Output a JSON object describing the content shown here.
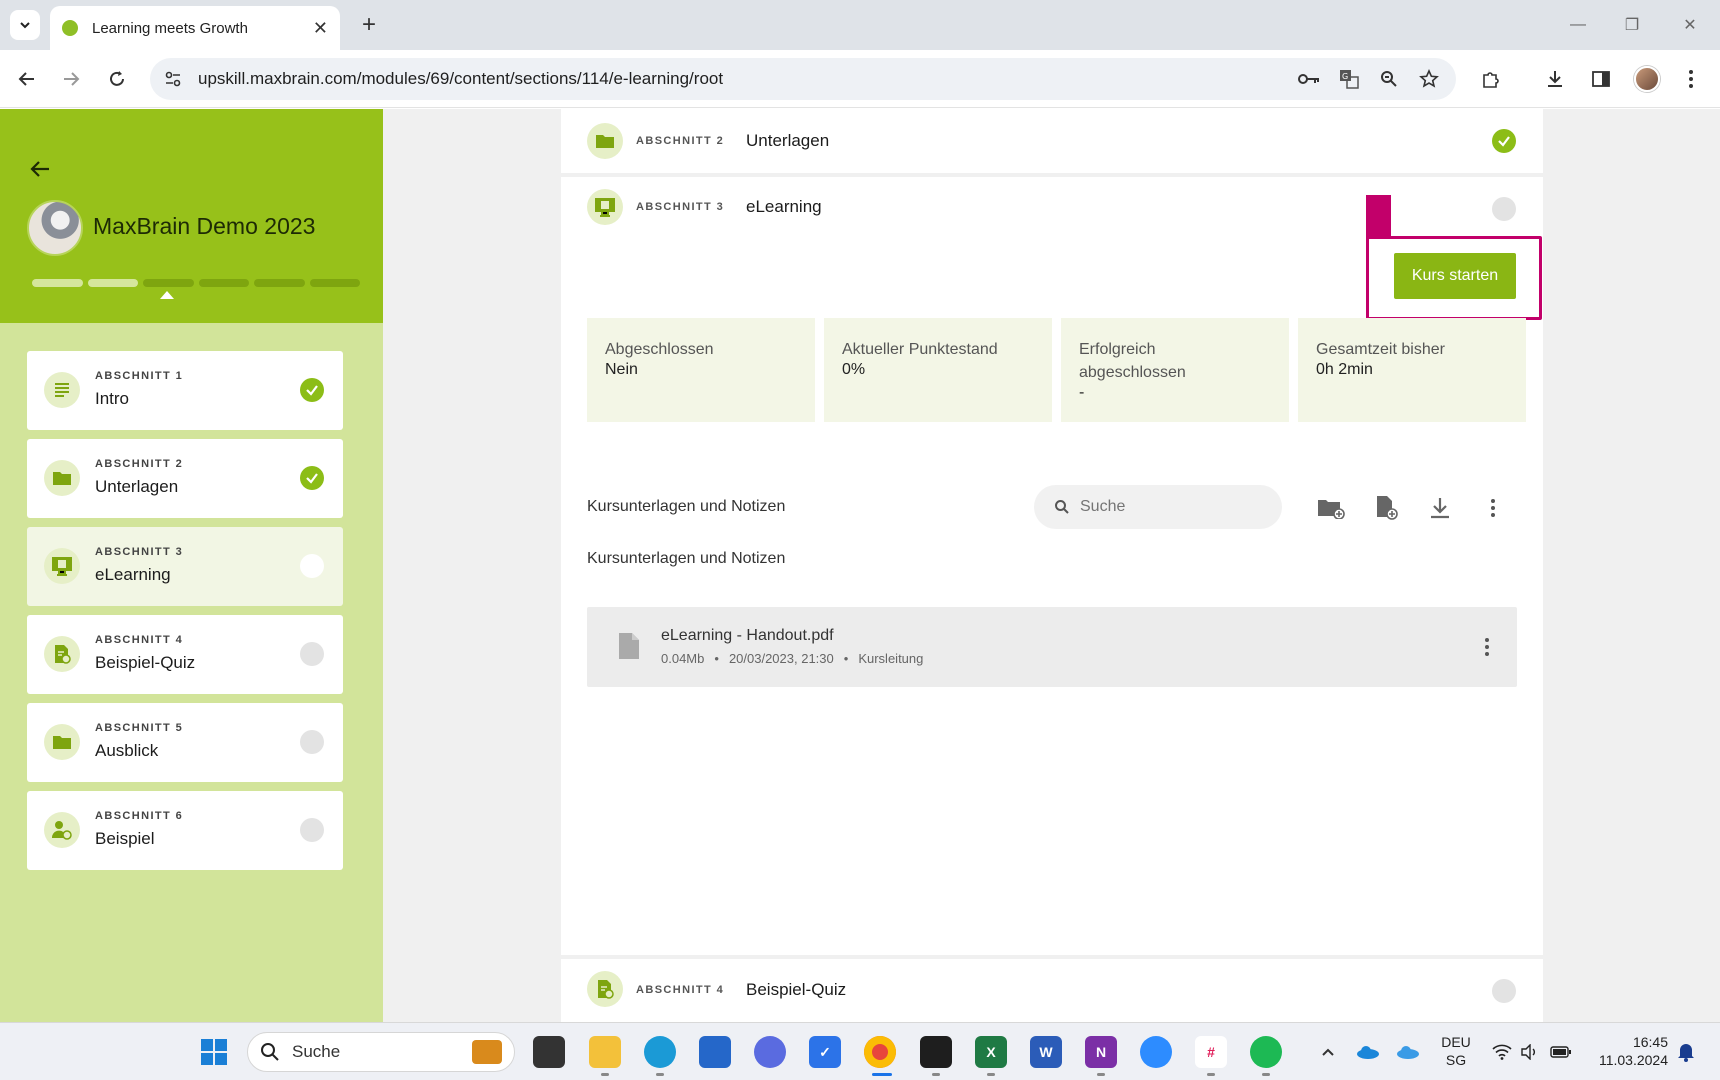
{
  "browser": {
    "tab_title": "Learning meets Growth",
    "url": "upskill.maxbrain.com/modules/69/content/sections/114/e-learning/root"
  },
  "sidebar": {
    "course_title": "MaxBrain Demo 2023",
    "items": [
      {
        "section": "ABSCHNITT 1",
        "name": "Intro",
        "status": "done",
        "icon": "text-lines-icon"
      },
      {
        "section": "ABSCHNITT 2",
        "name": "Unterlagen",
        "status": "done",
        "icon": "folder-icon"
      },
      {
        "section": "ABSCHNITT 3",
        "name": "eLearning",
        "status": "open",
        "icon": "elearning-monitor-icon"
      },
      {
        "section": "ABSCHNITT 4",
        "name": "Beispiel-Quiz",
        "status": "open",
        "icon": "quiz-document-icon"
      },
      {
        "section": "ABSCHNITT 5",
        "name": "Ausblick",
        "status": "open",
        "icon": "folder-icon"
      },
      {
        "section": "ABSCHNITT 6",
        "name": "Beispiel",
        "status": "open",
        "icon": "person-clock-icon"
      }
    ]
  },
  "main": {
    "section2": {
      "section": "ABSCHNITT 2",
      "name": "Unterlagen"
    },
    "section3": {
      "section": "ABSCHNITT 3",
      "name": "eLearning"
    },
    "start_button": "Kurs starten",
    "stats": [
      {
        "label": "Abgeschlossen",
        "value": "Nein"
      },
      {
        "label": "Aktueller Punktestand",
        "value": "0%"
      },
      {
        "label": "Erfolgreich abgeschlossen",
        "value": "-"
      },
      {
        "label": "Gesamtzeit bisher",
        "value": "0h 2min"
      }
    ],
    "notes_heading": "Kursunterlagen und Notizen",
    "notes_subheading": "Kursunterlagen und Notizen",
    "search_placeholder": "Suche",
    "file": {
      "name": "eLearning - Handout.pdf",
      "size": "0.04Mb",
      "date": "20/03/2023, 21:30",
      "author": "Kursleitung"
    },
    "section4": {
      "section": "ABSCHNITT 4",
      "name": "Beispiel-Quiz"
    }
  },
  "taskbar": {
    "search_label": "Suche",
    "lang_top": "DEU",
    "lang_bottom": "SG",
    "time": "16:45",
    "date": "11.03.2024"
  },
  "colors": {
    "brand_green": "#97c11a",
    "button_green": "#8ab614",
    "highlight_magenta": "#c2006a"
  }
}
